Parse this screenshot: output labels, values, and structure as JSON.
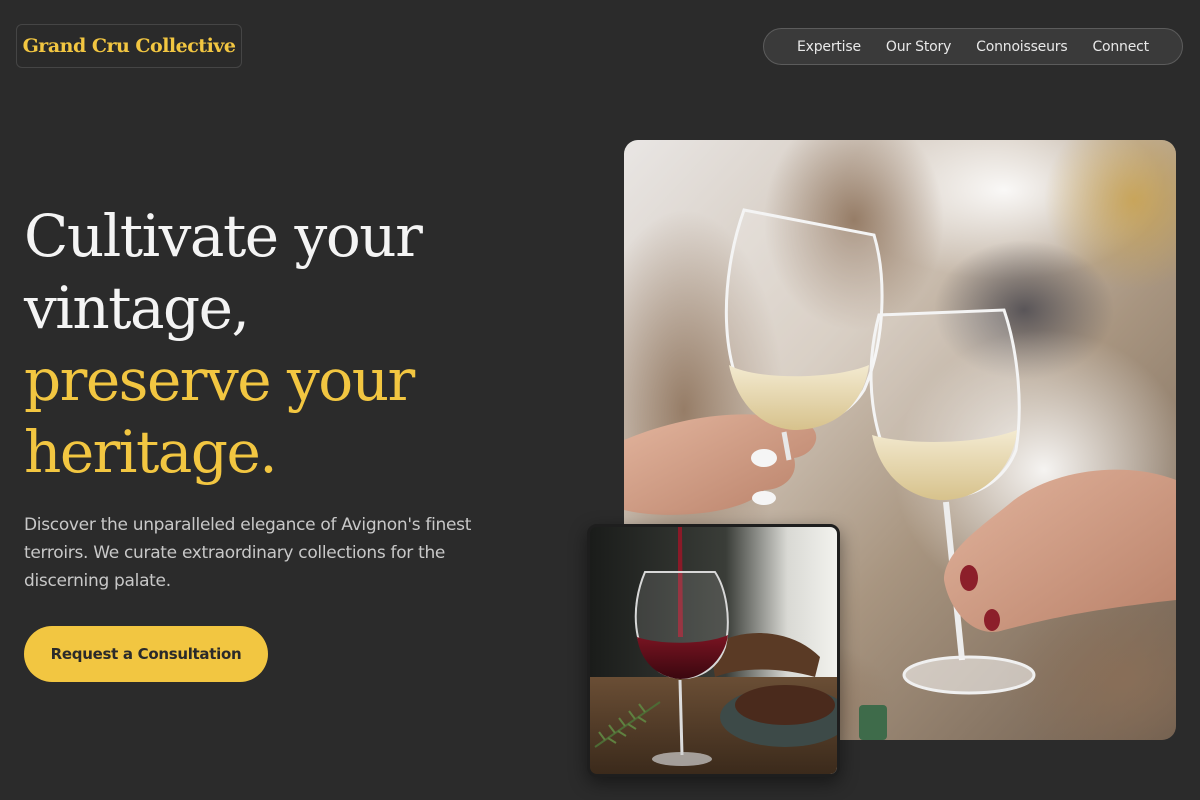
{
  "brand": {
    "name": "Grand Cru Collective"
  },
  "nav": {
    "items": [
      "Expertise",
      "Our Story",
      "Connoisseurs",
      "Connect"
    ]
  },
  "hero": {
    "headline_line1": "Cultivate your vintage,",
    "headline_line2": "preserve your heritage.",
    "description": "Discover the unparalleled elegance of Avignon's finest terroirs. We curate extraordinary collections for the discerning palate.",
    "cta_label": "Request a Consultation"
  },
  "images": {
    "main": "white-wine-toast-photo",
    "small": "red-wine-pour-photo"
  },
  "colors": {
    "background": "#2b2b2b",
    "accent": "#f2c641",
    "text_primary": "#f4f4f4",
    "text_secondary": "#c8c8c8"
  }
}
